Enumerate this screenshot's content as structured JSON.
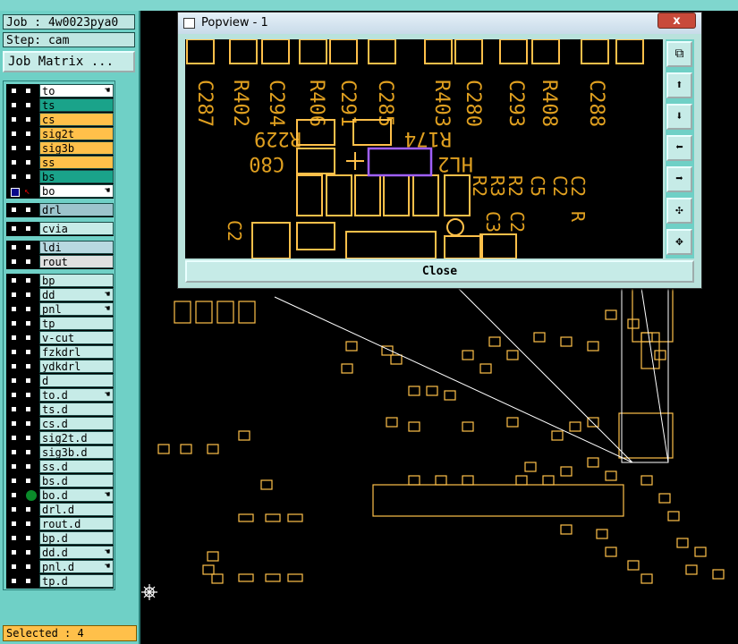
{
  "job_label": "Job : 4w0023pya0",
  "step_label": "Step: cam",
  "job_matrix_button": "Job Matrix ...",
  "layers": [
    {
      "name": "to",
      "color": "#ffffff",
      "hand": "☚"
    },
    {
      "name": "ts",
      "color": "#1aa38a",
      "hand": ""
    },
    {
      "name": "cs",
      "color": "#ffc04a",
      "hand": ""
    },
    {
      "name": "sig2t",
      "color": "#ffc04a",
      "hand": ""
    },
    {
      "name": "sig3b",
      "color": "#ffc04a",
      "hand": ""
    },
    {
      "name": "ss",
      "color": "#ffc04a",
      "hand": ""
    },
    {
      "name": "bs",
      "color": "#1aa38a",
      "hand": ""
    },
    {
      "name": "bo",
      "color": "#ffffff",
      "hand": "☚"
    },
    {
      "name": "drl",
      "color": "#9cc4cc",
      "hand": ""
    },
    {
      "name": "cvia",
      "color": "#c6ebe7",
      "hand": ""
    },
    {
      "name": "ldi",
      "color": "#b8d8e0",
      "hand": ""
    },
    {
      "name": "rout",
      "color": "#e0e0e0",
      "hand": ""
    },
    {
      "name": "bp",
      "color": "#c6ebe7",
      "hand": ""
    },
    {
      "name": "dd",
      "color": "#c6ebe7",
      "hand": "☚"
    },
    {
      "name": "pnl",
      "color": "#c6ebe7",
      "hand": "☚"
    },
    {
      "name": "tp",
      "color": "#c6ebe7",
      "hand": ""
    },
    {
      "name": "v-cut",
      "color": "#c6ebe7",
      "hand": ""
    },
    {
      "name": "fzkdrl",
      "color": "#c6ebe7",
      "hand": ""
    },
    {
      "name": "ydkdrl",
      "color": "#c6ebe7",
      "hand": ""
    },
    {
      "name": "d",
      "color": "#c6ebe7",
      "hand": ""
    },
    {
      "name": "to.d",
      "color": "#c6ebe7",
      "hand": "☚"
    },
    {
      "name": "ts.d",
      "color": "#c6ebe7",
      "hand": ""
    },
    {
      "name": "cs.d",
      "color": "#c6ebe7",
      "hand": ""
    },
    {
      "name": "sig2t.d",
      "color": "#c6ebe7",
      "hand": ""
    },
    {
      "name": "sig3b.d",
      "color": "#c6ebe7",
      "hand": ""
    },
    {
      "name": "ss.d",
      "color": "#c6ebe7",
      "hand": ""
    },
    {
      "name": "bs.d",
      "color": "#c6ebe7",
      "hand": ""
    },
    {
      "name": "bo.d",
      "color": "#c6ebe7",
      "hand": "☚"
    },
    {
      "name": "drl.d",
      "color": "#c6ebe7",
      "hand": ""
    },
    {
      "name": "rout.d",
      "color": "#c6ebe7",
      "hand": ""
    },
    {
      "name": "bp.d",
      "color": "#c6ebe7",
      "hand": ""
    },
    {
      "name": "dd.d",
      "color": "#c6ebe7",
      "hand": "☚"
    },
    {
      "name": "pnl.d",
      "color": "#c6ebe7",
      "hand": "☚"
    },
    {
      "name": "tp.d",
      "color": "#c6ebe7",
      "hand": ""
    }
  ],
  "selected_label": "Selected : 4",
  "popview": {
    "title": "Popview - 1",
    "close_x": "x",
    "close_button": "Close",
    "silk_labels": {
      "row1": [
        "C287",
        "R402",
        "C294",
        "R406",
        "C291",
        "C285",
        "R403",
        "C280",
        "C293",
        "R408",
        "C288"
      ],
      "mid": [
        "R229",
        "R174",
        "C80",
        "HL2"
      ],
      "right": [
        "R2",
        "R3",
        "R2",
        "C5",
        "C2",
        "C2",
        "C3",
        "C2",
        "R"
      ],
      "bottom": [
        "C2"
      ]
    }
  },
  "colors": {
    "panel": "#6fd0c6",
    "copper": "#ffc04a",
    "silk": "#e0a020",
    "highlight": "#a060ff"
  }
}
